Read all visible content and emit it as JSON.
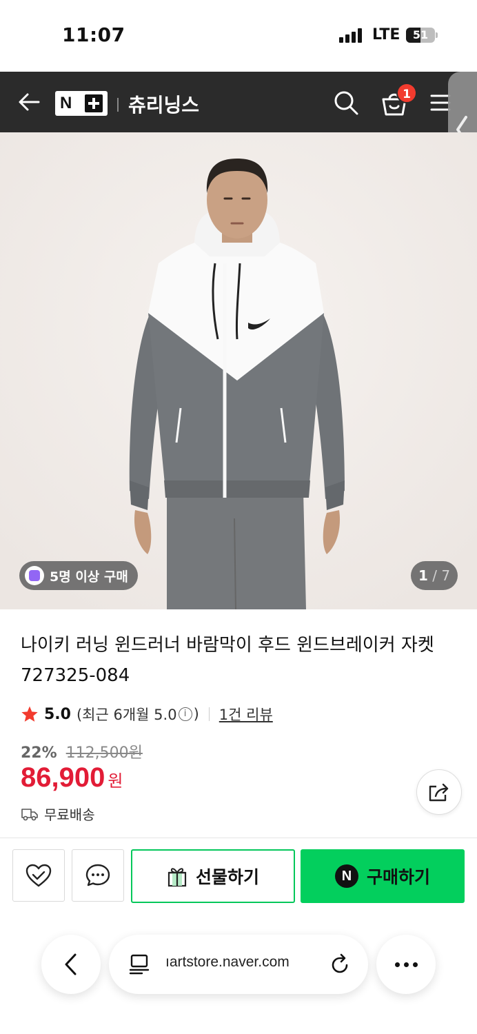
{
  "status_bar": {
    "time": "11:07",
    "network": "LTE",
    "battery": "51",
    "battery_level": 0.51
  },
  "header": {
    "store_name": "츄리닝스",
    "cart_count": "1",
    "logo_text": "N"
  },
  "gallery": {
    "group_badge": "5명 이상 구매",
    "page_current": "1",
    "page_total": "/ 7"
  },
  "product": {
    "title": "나이키 러닝 윈드러너 바람막이 후드 윈드브레이커 자켓 727325-084",
    "rating_score": "5.0",
    "rating_recent_prefix": "(최근 6개월 5.0",
    "rating_recent_suffix": ")",
    "review_link": "1건 리뷰",
    "discount_rate": "22%",
    "original_price": "112,500원",
    "price": "86,900",
    "price_unit": "원",
    "shipping": "무료배송"
  },
  "actions": {
    "gift_label": "선물하기",
    "buy_label": "구매하기"
  },
  "browser": {
    "url": "ıartstore.naver.com"
  },
  "colors": {
    "header_bg": "#2b2b2b",
    "price_red": "#e21c36",
    "naver_green": "#03cf5d",
    "badge_red": "#f23b2e"
  },
  "icons": [
    "back-arrow-icon",
    "search-icon",
    "cart-icon",
    "menu-icon",
    "chevron-left-icon",
    "star-icon",
    "info-icon",
    "truck-icon",
    "share-icon",
    "heart-icon",
    "chat-icon",
    "gift-icon",
    "reader-icon",
    "reload-icon",
    "more-icon"
  ]
}
